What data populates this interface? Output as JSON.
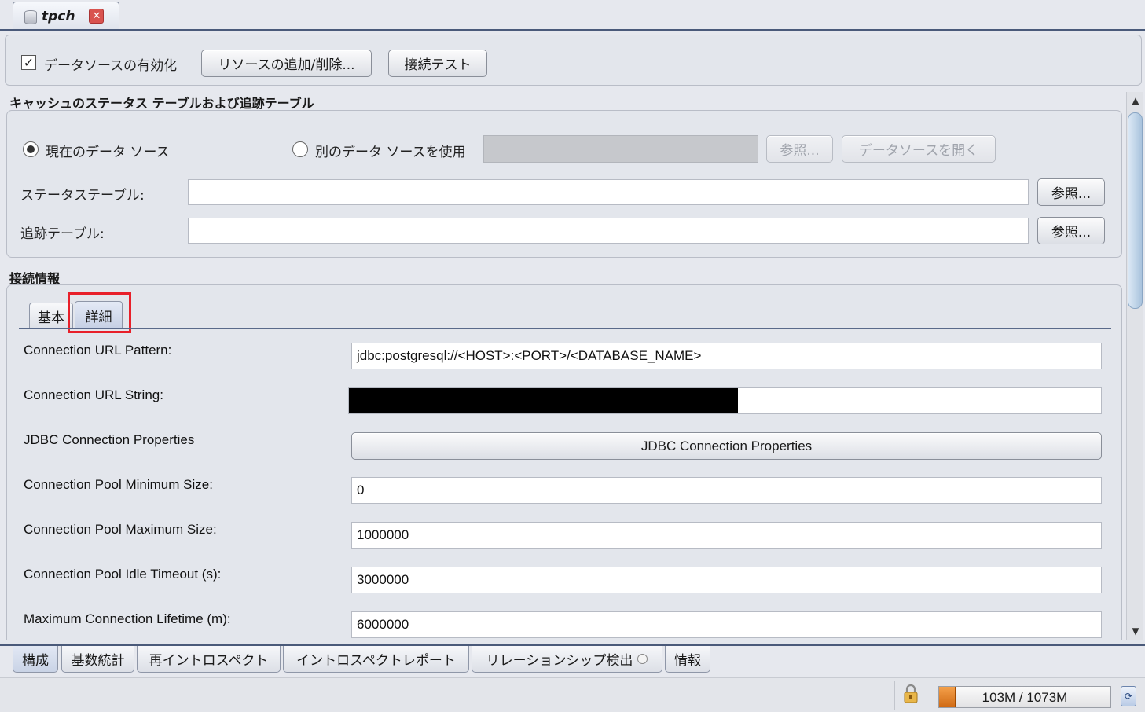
{
  "doc_tab": {
    "title": "tpch"
  },
  "toolbar": {
    "enable_datasource_label": "データソースの有効化",
    "enable_checked": true,
    "add_remove_resources_label": "リソースの追加/削除...",
    "connection_test_label": "接続テスト"
  },
  "cache_section": {
    "title": "キャッシュのステータス テーブルおよび追跡テーブル",
    "current_datasource_label": "現在のデータ ソース",
    "other_datasource_label": "別のデータ ソースを使用",
    "other_datasource_value": "",
    "browse_label": "参照...",
    "open_datasource_label": "データソースを開く",
    "status_table_label": "ステータステーブル:",
    "status_table_value": "",
    "tracking_table_label": "追跡テーブル:",
    "tracking_table_value": ""
  },
  "connection_section": {
    "title": "接続情報",
    "tabs": [
      {
        "label": "基本"
      },
      {
        "label": "詳細"
      }
    ],
    "fields": {
      "url_pattern_label": "Connection URL Pattern:",
      "url_pattern_value": "jdbc:postgresql://<HOST>:<PORT>/<DATABASE_NAME>",
      "url_string_label": "Connection URL String:",
      "jdbc_props_label": "JDBC Connection Properties",
      "jdbc_props_button": "JDBC Connection Properties",
      "pool_min_label": "Connection Pool Minimum Size:",
      "pool_min_value": "0",
      "pool_max_label": "Connection Pool Maximum Size:",
      "pool_max_value": "1000000",
      "idle_timeout_label": "Connection Pool Idle Timeout (s):",
      "idle_timeout_value": "3000000",
      "max_lifetime_label": "Maximum Connection Lifetime (m):",
      "max_lifetime_value": "6000000"
    }
  },
  "bottom_tabs": [
    {
      "label": "構成"
    },
    {
      "label": "基数統計"
    },
    {
      "label": "再イントロスペクト"
    },
    {
      "label": "イントロスペクトレポート"
    },
    {
      "label": "リレーションシップ検出"
    },
    {
      "label": "情報"
    }
  ],
  "status": {
    "memory": "103M / 1073M",
    "memory_used_fraction": 0.096
  },
  "colors": {
    "highlight": "#e8202a",
    "accent": "#4a5a7a",
    "memory_bar": "#e07a1e"
  }
}
